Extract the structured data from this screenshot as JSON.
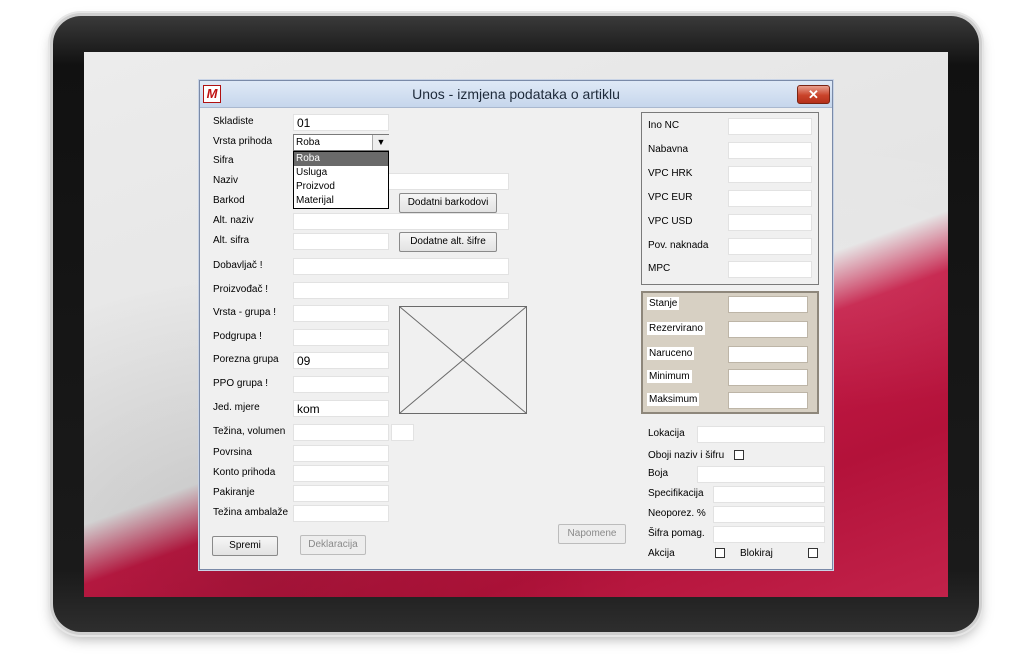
{
  "window": {
    "title": "Unos - izmjena podataka o artiklu",
    "icon_letter": "M",
    "close_glyph": "✕"
  },
  "fields": {
    "skladiste": {
      "label": "Skladiste",
      "value": "01"
    },
    "vrsta_prihoda": {
      "label": "Vrsta prihoda",
      "value": "Roba",
      "options": [
        "Roba",
        "Usluga",
        "Proizvod",
        "Materijal"
      ]
    },
    "sifra": {
      "label": "Sifra",
      "value": ""
    },
    "naziv": {
      "label": "Naziv",
      "value": ""
    },
    "barkod": {
      "label": "Barkod",
      "value": ""
    },
    "alt_naziv": {
      "label": "Alt. naziv",
      "value": ""
    },
    "alt_sifra": {
      "label": "Alt. sifra",
      "value": ""
    },
    "dobavljac": {
      "label": "Dobavljač !",
      "value": ""
    },
    "proizvodac": {
      "label": "Proizvođač !",
      "value": ""
    },
    "vrsta_grupa": {
      "label": "Vrsta - grupa !",
      "value": ""
    },
    "podgrupa": {
      "label": "Podgrupa !",
      "value": ""
    },
    "porezna_grupa": {
      "label": "Porezna grupa",
      "value": "09"
    },
    "ppo_grupa": {
      "label": "PPO grupa !",
      "value": ""
    },
    "jed_mjere": {
      "label": "Jed. mjere",
      "value": "kom"
    },
    "tezina_volumen": {
      "label": "Težina, volumen",
      "value": ""
    },
    "povrsina": {
      "label": "Povrsina",
      "value": ""
    },
    "konto_prihoda": {
      "label": "Konto prihoda",
      "value": ""
    },
    "pakiranje": {
      "label": "Pakiranje",
      "value": ""
    },
    "tezina_ambalaze": {
      "label": "Težina ambalaže",
      "value": ""
    }
  },
  "buttons": {
    "dodatni_barkodovi": "Dodatni barkodovi",
    "dodatne_alt_sifre": "Dodatne alt. šifre",
    "spremi": "Spremi",
    "deklaracija": "Deklaracija",
    "napomene": "Napomene"
  },
  "prices": [
    {
      "label": "Ino NC",
      "value": ""
    },
    {
      "label": "Nabavna",
      "value": ""
    },
    {
      "label": "VPC HRK",
      "value": ""
    },
    {
      "label": "VPC EUR",
      "value": ""
    },
    {
      "label": "VPC USD",
      "value": ""
    },
    {
      "label": "Pov. naknada",
      "value": ""
    },
    {
      "label": "MPC",
      "value": ""
    }
  ],
  "stock": [
    {
      "label": "Stanje",
      "value": ""
    },
    {
      "label": "Rezervirano",
      "value": ""
    },
    {
      "label": "Naruceno",
      "value": ""
    },
    {
      "label": "Minimum",
      "value": ""
    },
    {
      "label": "Maksimum",
      "value": ""
    }
  ],
  "right_fields": {
    "lokacija": {
      "label": "Lokacija",
      "value": ""
    },
    "oboji": {
      "label": "Oboji naziv i šifru",
      "checked": false
    },
    "boja": {
      "label": "Boja",
      "value": ""
    },
    "specifikacija": {
      "label": "Specifikacija",
      "value": ""
    },
    "neoporez": {
      "label": "Neoporez. %",
      "value": ""
    },
    "sifra_pomag": {
      "label": "Šifra pomag.",
      "value": ""
    },
    "akcija": {
      "label": "Akcija",
      "checked": false
    },
    "blokiraj": {
      "label": "Blokiraj",
      "checked": false
    }
  },
  "colors": {
    "accent_red": "#c41a45",
    "window_bg": "#f0f0f0",
    "stock_panel_bg": "#d7d0c3"
  }
}
